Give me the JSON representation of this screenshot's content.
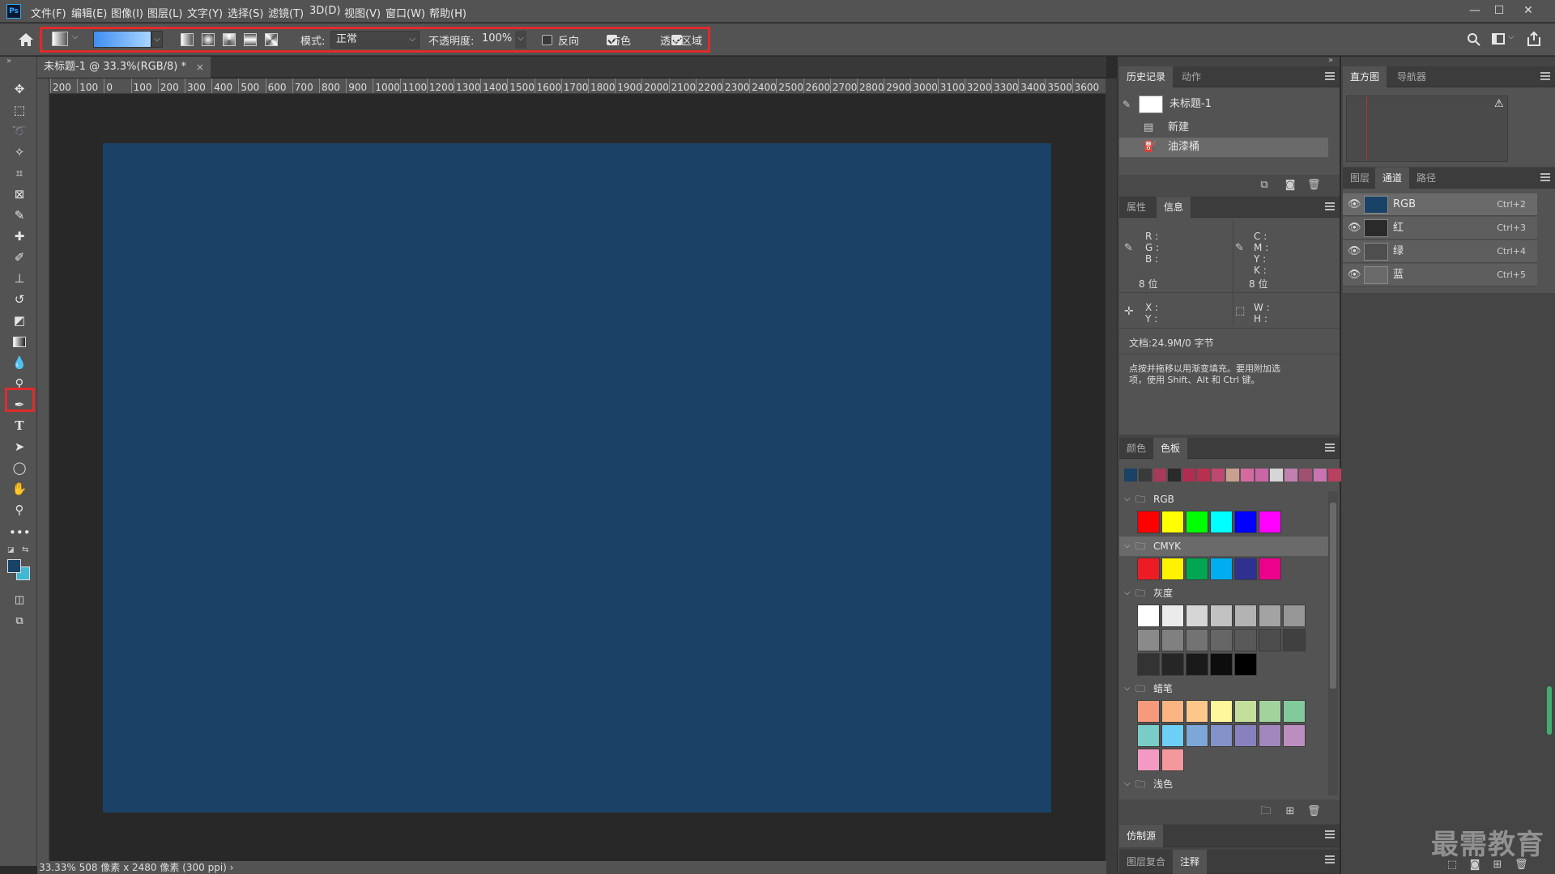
{
  "app": {
    "logo": "Ps"
  },
  "menu": [
    "文件(F)",
    "编辑(E)",
    "图像(I)",
    "图层(L)",
    "文字(Y)",
    "选择(S)",
    "滤镜(T)",
    "3D(D)",
    "视图(V)",
    "窗口(W)",
    "帮助(H)"
  ],
  "window_controls": {
    "minimize": "—",
    "maximize": "☐",
    "close": "✕"
  },
  "options": {
    "mode_label": "模式:",
    "mode_value": "正常",
    "opacity_label": "不透明度:",
    "opacity_value": "100%",
    "reverse_label": "反向",
    "dither_label": "仿色",
    "transparency_label": "透明区域",
    "reverse_checked": false,
    "dither_checked": true,
    "transparency_checked": true,
    "gradient_colors": [
      "#3f8ff0",
      "#a9d4ff"
    ]
  },
  "document": {
    "tab_title": "未标题-1 @ 33.3%(RGB/8) *",
    "tab_close": "×",
    "canvas_color": "#1a4266",
    "status": "33.33%  508 像素 x 2480 像素 (300 ppi)  ›"
  },
  "ruler": {
    "h_ticks": [
      "200",
      "100",
      "0",
      "100",
      "200",
      "300",
      "400",
      "500",
      "600",
      "700",
      "800",
      "900",
      "1000",
      "1100",
      "1200",
      "1300",
      "1400",
      "1500",
      "1600",
      "1700",
      "1800",
      "1900",
      "2000",
      "2100",
      "2200",
      "2300",
      "2400",
      "2500",
      "2600",
      "2700",
      "2800",
      "2900",
      "3000",
      "3100",
      "3200",
      "3300",
      "3400",
      "3500",
      "3600"
    ]
  },
  "history": {
    "tabs": [
      "历史记录",
      "动作"
    ],
    "snapshot": "未标题-1",
    "items": [
      "新建",
      "油漆桶"
    ]
  },
  "info": {
    "tabs": [
      "属性",
      "信息"
    ],
    "rgb_labels": [
      "R :",
      "G :",
      "B :"
    ],
    "cmyk_labels": [
      "C :",
      "M :",
      "Y :",
      "K :"
    ],
    "bits_left": "8 位",
    "bits_right": "8 位",
    "xy_labels": [
      "X :",
      "Y :"
    ],
    "wh_labels": [
      "W :",
      "H :"
    ],
    "doc_size": "文档:24.9M/0 字节",
    "hint_line1": "点按并拖移以用渐变填充。要用附加选",
    "hint_line2": "项，使用 Shift、Alt 和 Ctrl 键。"
  },
  "swatches": {
    "tabs": [
      "颜色",
      "色板"
    ],
    "recent": [
      "#1a4266",
      "#3a3a3a",
      "#a63a5a",
      "#2a2a2a",
      "#b02d52",
      "#b8304f",
      "#c04870",
      "#c9a08f",
      "#d46aa0",
      "#c966a5",
      "#d5d5d5",
      "#c080b0",
      "#a05070",
      "#c774b0",
      "#b84060"
    ],
    "groups": [
      {
        "name": "RGB",
        "colors": [
          "#ff0000",
          "#ffff00",
          "#00ff00",
          "#00ffff",
          "#0000ff",
          "#ff00ff"
        ]
      },
      {
        "name": "CMYK",
        "colors": [
          "#ed1c24",
          "#fff200",
          "#00a651",
          "#00aeef",
          "#2e3192",
          "#ec008c"
        ]
      },
      {
        "name": "灰度",
        "colors": [
          "#ffffff",
          "#ebebeb",
          "#d6d6d6",
          "#c2c2c2",
          "#b3b3b3",
          "#a3a3a3",
          "#969696",
          "#8a8a8a",
          "#808080",
          "#737373",
          "#666666",
          "#595959",
          "#4d4d4d",
          "#404040",
          "#333333",
          "#262626",
          "#1a1a1a",
          "#0d0d0d",
          "#000000"
        ]
      },
      {
        "name": "蜡笔",
        "colors": [
          "#f59b7c",
          "#f9b482",
          "#fdc68a",
          "#fff799",
          "#c4df9b",
          "#a2d39c",
          "#82ca9c",
          "#7accc8",
          "#6dcff6",
          "#7da7d9",
          "#8393ca",
          "#8781bd",
          "#a187be",
          "#bc8dbf",
          "#f49ac2",
          "#f5989d"
        ]
      },
      {
        "name": "浅色",
        "colors": []
      }
    ]
  },
  "bottom_panels": {
    "clone_source": "仿制源",
    "tabs": [
      "图层复合",
      "注释"
    ]
  },
  "right_column": {
    "top_tabs": [
      "直方图",
      "导航器"
    ],
    "channel_tabs": [
      "图层",
      "通道",
      "路径"
    ],
    "channels": [
      {
        "name": "RGB",
        "shortcut": "Ctrl+2",
        "thumb": "#1a4266"
      },
      {
        "name": "红",
        "shortcut": "Ctrl+3",
        "thumb": "#2a2a2a"
      },
      {
        "name": "绿",
        "shortcut": "Ctrl+4",
        "thumb": "#4e4e4e"
      },
      {
        "name": "蓝",
        "shortcut": "Ctrl+5",
        "thumb": "#6a6a6a"
      }
    ]
  },
  "watermark": "最需教育"
}
